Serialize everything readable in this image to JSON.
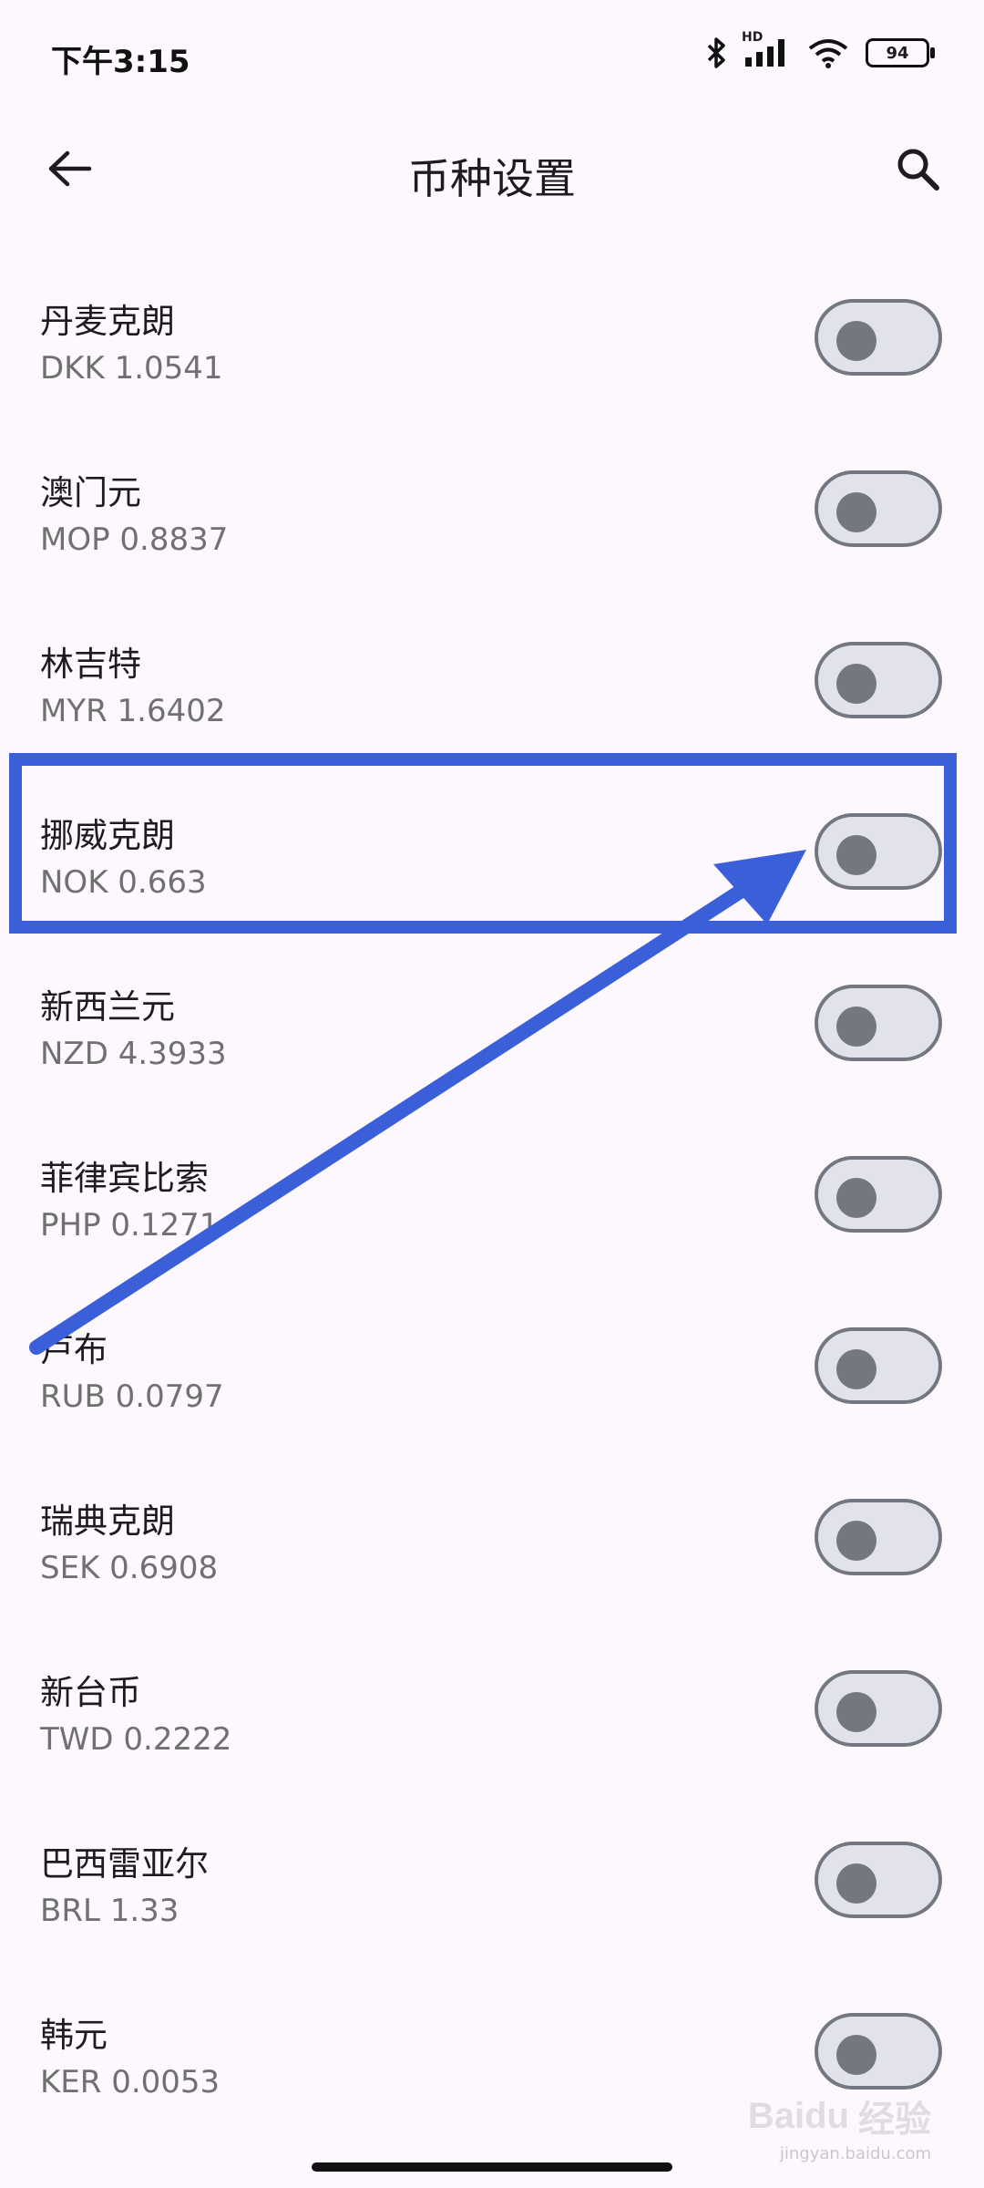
{
  "status_bar": {
    "time": "下午3:15",
    "network_label": "HD",
    "battery": "94",
    "icons": [
      "bluetooth-icon",
      "signal-icon",
      "wifi-icon",
      "battery-icon"
    ]
  },
  "app_bar": {
    "title": "币种设置",
    "back_icon": "arrow-left-icon",
    "search_icon": "search-icon"
  },
  "currencies": [
    {
      "name": "丹麦克朗",
      "code_rate": "DKK 1.0541",
      "enabled": false
    },
    {
      "name": "澳门元",
      "code_rate": "MOP 0.8837",
      "enabled": false
    },
    {
      "name": "林吉特",
      "code_rate": "MYR 1.6402",
      "enabled": false
    },
    {
      "name": "挪威克朗",
      "code_rate": "NOK 0.663",
      "enabled": false
    },
    {
      "name": "新西兰元",
      "code_rate": "NZD 4.3933",
      "enabled": false
    },
    {
      "name": "菲律宾比索",
      "code_rate": "PHP 0.1271",
      "enabled": false
    },
    {
      "name": "卢布",
      "code_rate": "RUB 0.0797",
      "enabled": false
    },
    {
      "name": "瑞典克朗",
      "code_rate": "SEK 0.6908",
      "enabled": false
    },
    {
      "name": "新台币",
      "code_rate": "TWD 0.2222",
      "enabled": false
    },
    {
      "name": "巴西雷亚尔",
      "code_rate": "BRL 1.33",
      "enabled": false
    },
    {
      "name": "韩元",
      "code_rate": "KER 0.0053",
      "enabled": false
    }
  ],
  "annotation": {
    "highlighted_item": "挪威克朗",
    "color": "#3b5fd8"
  },
  "watermark": {
    "logo": "Baidu",
    "text": "经验",
    "url": "jingyan.baidu.com"
  }
}
